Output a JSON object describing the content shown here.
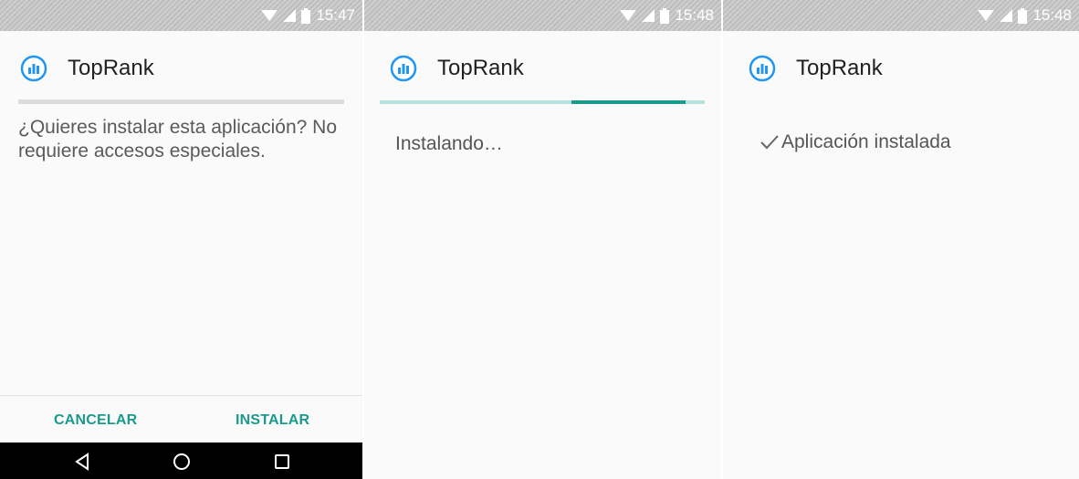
{
  "colors": {
    "accent": "#1a9a8c",
    "progress_track": "#b7e1dc",
    "icon_blue": "#2196f3",
    "text_primary": "#212121",
    "text_secondary": "#555555"
  },
  "icons": {
    "wifi": "wifi-icon",
    "signal": "signal-icon",
    "battery": "battery-icon",
    "app": "bar-chart-icon",
    "check": "check-icon",
    "back": "back-triangle-icon",
    "home": "home-circle-icon",
    "recent": "recent-square-icon"
  },
  "screens": [
    {
      "status_time": "15:47",
      "app_name": "TopRank",
      "message": "¿Quieres instalar esta aplicación? No requiere accesos especiales.",
      "buttons": {
        "cancel": "CANCELAR",
        "install": "INSTALAR"
      }
    },
    {
      "status_time": "15:48",
      "app_name": "TopRank",
      "message": "Instalando…",
      "progress": {
        "start": 0.59,
        "end": 0.94
      }
    },
    {
      "status_time": "15:48",
      "app_name": "TopRank",
      "message": "Aplicación instalada"
    }
  ]
}
